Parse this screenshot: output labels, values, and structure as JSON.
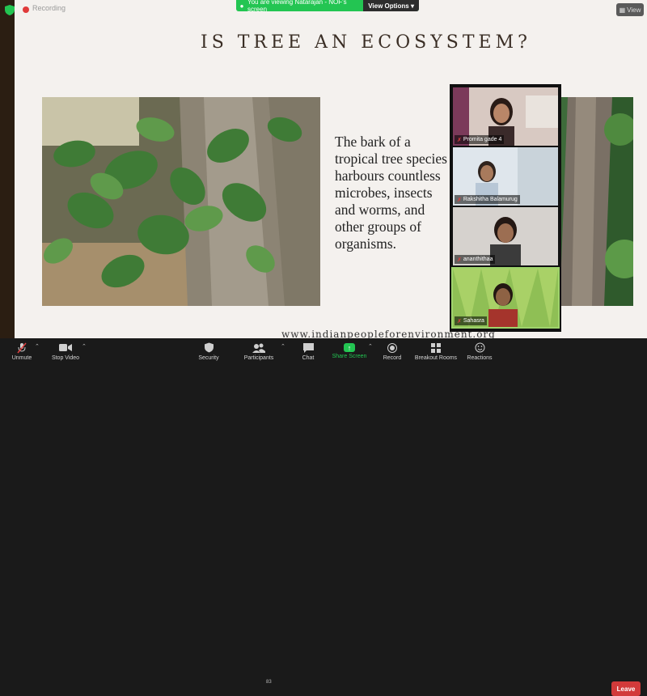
{
  "meeting": {
    "recording_label": "Recording",
    "share_banner_text": "You are viewing Natarajan - NOF's screen",
    "view_options_label": "View Options",
    "view_button_label": "View"
  },
  "slide": {
    "title": "IS TREE AN ECOSYSTEM?",
    "body_text": "The bark of a tropical tree species harbours countless microbes, insects and worms, and other groups of organisms.",
    "footer_text": "www.indianpeopleforenvironment.org"
  },
  "gallery": {
    "participants": [
      {
        "name": "Promita gade 4",
        "muted": true
      },
      {
        "name": "Rakshitha Balamurug",
        "muted": true
      },
      {
        "name": "ananthithaa",
        "muted": true
      },
      {
        "name": "Sahasra",
        "muted": true
      }
    ]
  },
  "toolbar": {
    "unmute": "Unmute",
    "stop_video": "Stop Video",
    "security": "Security",
    "participants": "Participants",
    "participant_count": "83",
    "chat": "Chat",
    "share_screen": "Share Screen",
    "record": "Record",
    "breakout_rooms": "Breakout Rooms",
    "reactions": "Reactions",
    "leave": "Leave"
  },
  "colors": {
    "share_green": "#23c552",
    "leave_red": "#d23a3a",
    "slide_background": "#f4f1ee",
    "title_color": "#3a2e25"
  }
}
